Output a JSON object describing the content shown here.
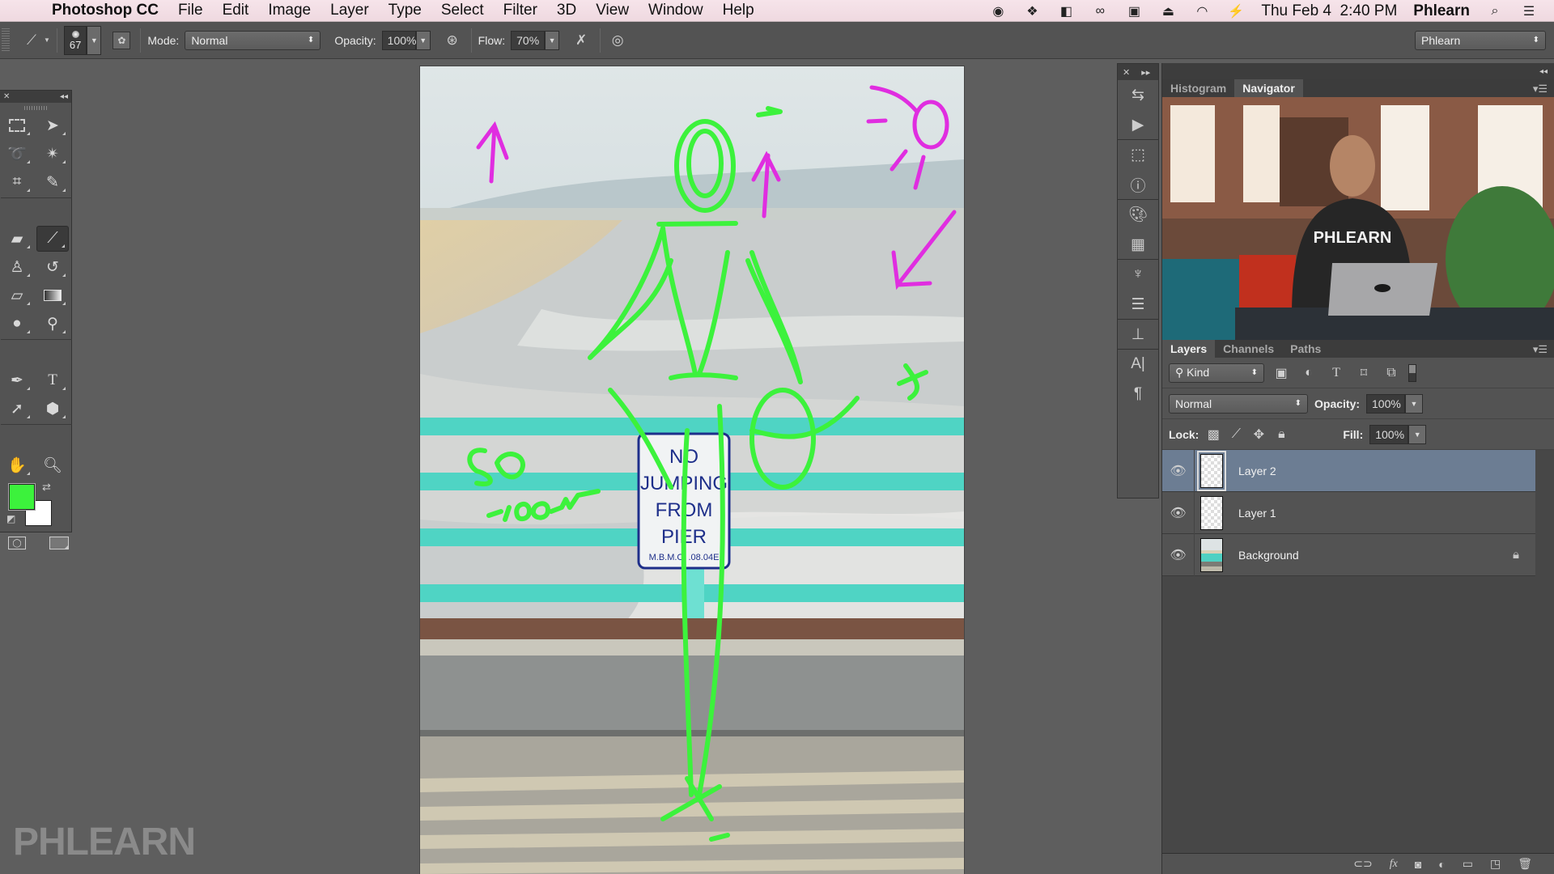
{
  "menubar": {
    "app_name": "Photoshop CC",
    "menus": [
      "File",
      "Edit",
      "Image",
      "Layer",
      "Type",
      "Select",
      "Filter",
      "3D",
      "View",
      "Window",
      "Help"
    ],
    "status_icons": [
      "record-icon",
      "dropbox-icon",
      "display-icon",
      "creative-cloud-icon",
      "battery-plug-icon",
      "airplay-icon",
      "wifi-icon",
      "battery-icon"
    ],
    "clock": "Thu Feb 4  2:40 PM",
    "user": "Phlearn"
  },
  "options_bar": {
    "brush_size": "67",
    "mode_label": "Mode:",
    "mode_value": "Normal",
    "opacity_label": "Opacity:",
    "opacity_value": "100%",
    "flow_label": "Flow:",
    "flow_value": "70%",
    "workspace": "Phlearn"
  },
  "tools": {
    "rows": [
      [
        "rectangular-marquee",
        "move"
      ],
      [
        "lasso",
        "magic-wand"
      ],
      [
        "crop",
        "eyedropper"
      ],
      [
        "healing-brush",
        "brush"
      ],
      [
        "clone-stamp",
        "history-brush"
      ],
      [
        "eraser",
        "gradient"
      ],
      [
        "blur",
        "dodge"
      ],
      [
        "pen",
        "type"
      ],
      [
        "path-selection",
        "shape"
      ],
      [
        "hand",
        "zoom"
      ]
    ],
    "active": "brush",
    "foreground_color": "#3cf23c",
    "background_color": "#ffffff"
  },
  "canvas": {
    "sign_lines": [
      "NO",
      "JUMPING",
      "FROM",
      "PIER"
    ],
    "sign_code": "M.B.M.C.  .08.04E",
    "annotation_text": [
      "50",
      "100mm"
    ]
  },
  "watermark": "PHLEARN",
  "right_panel": {
    "top_tabs": [
      {
        "label": "Histogram",
        "active": false
      },
      {
        "label": "Navigator",
        "active": true
      }
    ],
    "navigator_shirt_text": "PHLEARN",
    "layer_tabs": [
      {
        "label": "Layers",
        "active": true
      },
      {
        "label": "Channels",
        "active": false
      },
      {
        "label": "Paths",
        "active": false
      }
    ],
    "filter_kind": "Kind",
    "blend_mode": "Normal",
    "opacity_label": "Opacity:",
    "opacity_value": "100%",
    "lock_label": "Lock:",
    "fill_label": "Fill:",
    "fill_value": "100%",
    "layers": [
      {
        "name": "Layer 2",
        "selected": true,
        "visible": true,
        "locked": false
      },
      {
        "name": "Layer 1",
        "selected": false,
        "visible": true,
        "locked": false
      },
      {
        "name": "Background",
        "selected": false,
        "visible": true,
        "locked": true
      }
    ]
  }
}
